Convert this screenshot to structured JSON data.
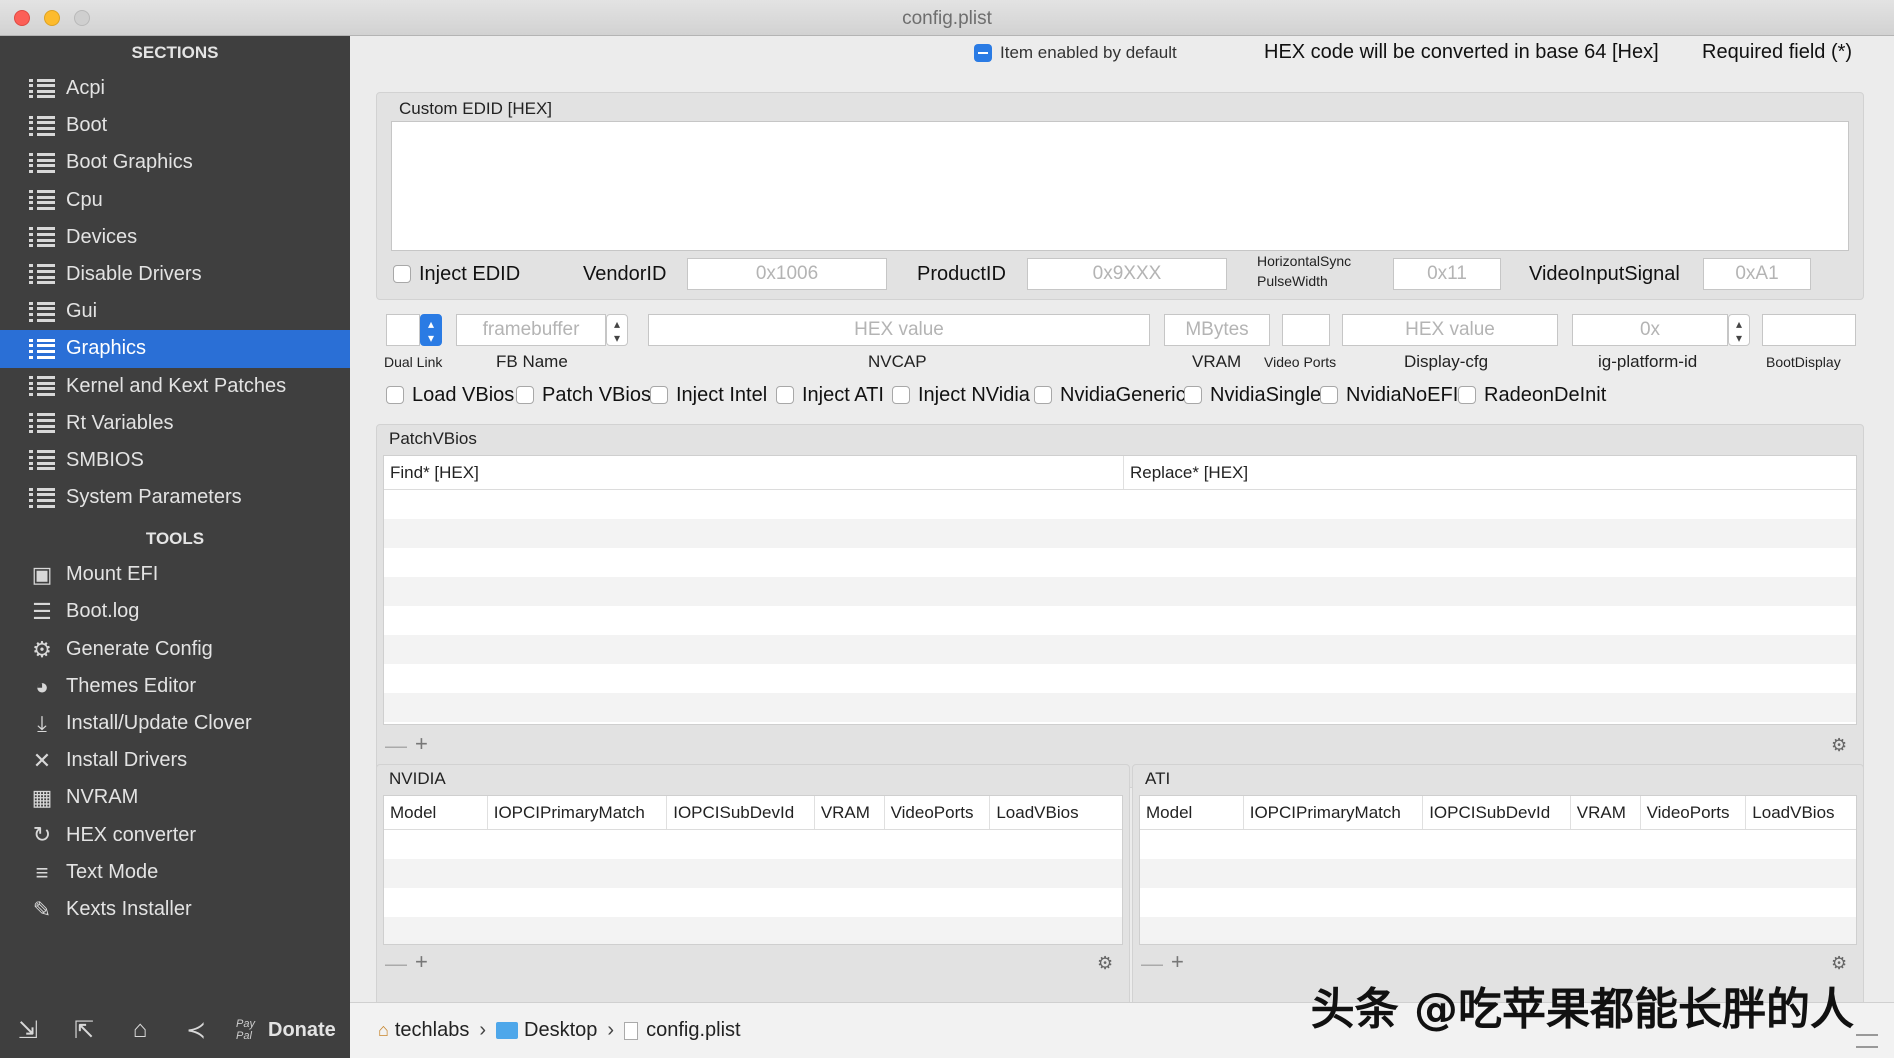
{
  "window": {
    "title": "config.plist"
  },
  "sidebar": {
    "sections_header": "SECTIONS",
    "sections": [
      {
        "label": "Acpi"
      },
      {
        "label": "Boot"
      },
      {
        "label": "Boot Graphics"
      },
      {
        "label": "Cpu"
      },
      {
        "label": "Devices"
      },
      {
        "label": "Disable Drivers"
      },
      {
        "label": "Gui"
      },
      {
        "label": "Graphics",
        "active": true
      },
      {
        "label": "Kernel and Kext Patches"
      },
      {
        "label": "Rt Variables"
      },
      {
        "label": "SMBIOS"
      },
      {
        "label": "System Parameters"
      }
    ],
    "tools_header": "TOOLS",
    "tools": [
      {
        "label": "Mount EFI",
        "icon": "disk-icon"
      },
      {
        "label": "Boot.log",
        "icon": "log-search-icon"
      },
      {
        "label": "Generate Config",
        "icon": "gears-icon"
      },
      {
        "label": "Themes Editor",
        "icon": "palette-icon"
      },
      {
        "label": "Install/Update Clover",
        "icon": "download-icon"
      },
      {
        "label": "Install Drivers",
        "icon": "tools-icon"
      },
      {
        "label": "NVRAM",
        "icon": "chip-icon"
      },
      {
        "label": "HEX converter",
        "icon": "refresh-icon"
      },
      {
        "label": "Text Mode",
        "icon": "text-icon"
      },
      {
        "label": "Kexts Installer",
        "icon": "brush-icon"
      }
    ],
    "bottom": {
      "paypal": "Pay Pal",
      "donate": "Donate"
    }
  },
  "header": {
    "item_enabled": "Item enabled by default",
    "hex_note": "HEX code will be converted in base 64 [Hex]",
    "required": "Required field (*)"
  },
  "edid": {
    "title": "Custom EDID [HEX]",
    "inject_label": "Inject EDID",
    "vendor_label": "VendorID",
    "vendor_ph": "0x1006",
    "product_label": "ProductID",
    "product_ph": "0x9XXX",
    "hsync_label_1": "HorizontalSync",
    "hsync_label_2": "PulseWidth",
    "hsync_ph": "0x11",
    "vis_label": "VideoInputSignal",
    "vis_ph": "0xA1"
  },
  "fb": {
    "fb_ph": "framebuffer",
    "nvcap_ph": "HEX value",
    "vram_ph": "MBytes",
    "dcfg_ph": "HEX value",
    "igp_ph": "0x",
    "dual_link": "Dual Link",
    "fb_name": "FB Name",
    "nvcap": "NVCAP",
    "vram": "VRAM",
    "video_ports": "Video Ports",
    "display_cfg": "Display-cfg",
    "ig_platform": "ig-platform-id",
    "boot_display": "BootDisplay"
  },
  "options": [
    "Load VBios",
    "Patch VBios",
    "Inject Intel",
    "Inject ATI",
    "Inject NVidia",
    "NvidiaGeneric",
    "NvidiaSingle",
    "NvidiaNoEFI",
    "RadeonDeInit"
  ],
  "patchvbios": {
    "title": "PatchVBios",
    "col_find": "Find* [HEX]",
    "col_replace": "Replace* [HEX]"
  },
  "nvidia": {
    "title": "NVIDIA",
    "cols": [
      "Model",
      "IOPCIPrimaryMatch",
      "IOPCISubDevId",
      "VRAM",
      "VideoPorts",
      "LoadVBios"
    ]
  },
  "ati": {
    "title": "ATI",
    "cols": [
      "Model",
      "IOPCIPrimaryMatch",
      "IOPCISubDevId",
      "VRAM",
      "VideoPorts",
      "LoadVBios"
    ]
  },
  "path": {
    "p1": "techlabs",
    "p2": "Desktop",
    "p3": "config.plist"
  },
  "watermark": "头条 @吃苹果都能长胖的人"
}
